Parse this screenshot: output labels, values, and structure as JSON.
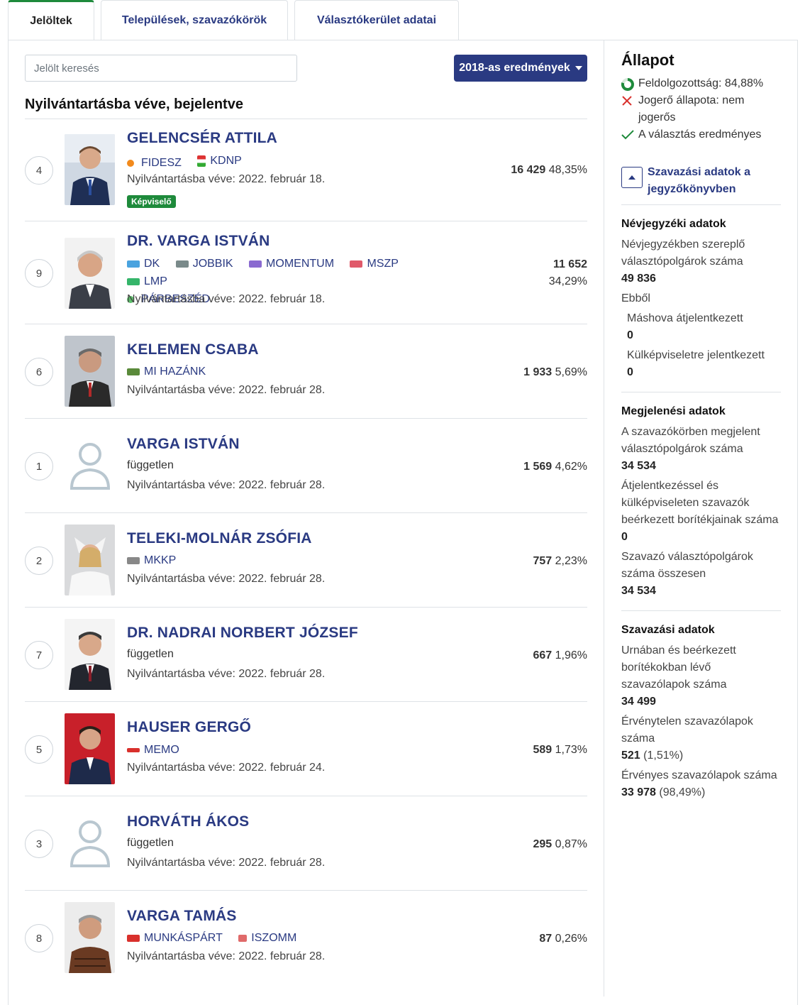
{
  "tabs": [
    {
      "label": "Jelöltek",
      "active": true
    },
    {
      "label": "Települések, szavazókörök",
      "active": false
    },
    {
      "label": "Választókerület adatai",
      "active": false
    }
  ],
  "search": {
    "placeholder": "Jelölt keresés"
  },
  "results_button": {
    "label": "2018-as eredmények"
  },
  "section_title": "Nyilvántartásba véve, bejelentve",
  "candidates": [
    {
      "number": "4",
      "name": "GELENCSÉR ATTILA",
      "parties": [
        "FIDESZ",
        "KDNP"
      ],
      "registered": "Nyilvántartásba véve: 2022. február 18.",
      "badge": "Képviselő",
      "votes": "16 429",
      "percent": "48,35%"
    },
    {
      "number": "9",
      "name": "DR. VARGA ISTVÁN",
      "parties": [
        "DK",
        "JOBBIK",
        "MOMENTUM",
        "MSZP",
        "LMP",
        "PÁRBESZÉD"
      ],
      "registered": "Nyilvántartásba véve: 2022. február 18.",
      "votes": "11 652",
      "percent": "34,29%"
    },
    {
      "number": "6",
      "name": "KELEMEN CSABA",
      "parties": [
        "MI HAZÁNK"
      ],
      "registered": "Nyilvántartásba véve: 2022. február 28.",
      "votes": "1 933",
      "percent": "5,69%"
    },
    {
      "number": "1",
      "name": "VARGA ISTVÁN",
      "independent": "független",
      "registered": "Nyilvántartásba véve: 2022. február 28.",
      "votes": "1 569",
      "percent": "4,62%"
    },
    {
      "number": "2",
      "name": "TELEKI-MOLNÁR ZSÓFIA",
      "parties": [
        "MKKP"
      ],
      "registered": "Nyilvántartásba véve: 2022. február 28.",
      "votes": "757",
      "percent": "2,23%"
    },
    {
      "number": "7",
      "name": "DR. NADRAI NORBERT JÓZSEF",
      "independent": "független",
      "registered": "Nyilvántartásba véve: 2022. február 28.",
      "votes": "667",
      "percent": "1,96%"
    },
    {
      "number": "5",
      "name": "HAUSER GERGŐ",
      "parties": [
        "MEMO"
      ],
      "registered": "Nyilvántartásba véve: 2022. február 24.",
      "votes": "589",
      "percent": "1,73%"
    },
    {
      "number": "3",
      "name": "HORVÁTH ÁKOS",
      "independent": "független",
      "registered": "Nyilvántartásba véve: 2022. február 28.",
      "votes": "295",
      "percent": "0,87%"
    },
    {
      "number": "8",
      "name": "VARGA TAMÁS",
      "parties": [
        "MUNKÁSPÁRT",
        "ISZOMM"
      ],
      "registered": "Nyilvántartásba véve: 2022. február 28.",
      "votes": "87",
      "percent": "0,26%"
    }
  ],
  "sidebar": {
    "title": "Állapot",
    "status": [
      {
        "icon": "progress-icon",
        "text": "Feldolgozottság: 84,88%"
      },
      {
        "icon": "cross-icon",
        "text": "Jogerő állapota: nem jogerős"
      },
      {
        "icon": "check-icon",
        "text": "A választás eredményes"
      }
    ],
    "protocol_button": "Szavazási adatok a jegyzőkönyvben",
    "registry": {
      "heading": "Névjegyzéki adatok",
      "label1": "Névjegyzékben szereplő választópolgárok száma",
      "value1": "49 836",
      "ebbol": "Ebből",
      "label2": "Máshova átjelentkezett",
      "value2": "0",
      "label3": "Külképviseletre jelentkezett",
      "value3": "0"
    },
    "turnout": {
      "heading": "Megjelenési adatok",
      "label1": "A szavazókörben megjelent választópolgárok száma",
      "value1": "34 534",
      "label2": "Átjelentkezéssel és külképviseleten szavazók beérkezett borítékjainak száma",
      "value2": "0",
      "label3": "Szavazó választópolgárok száma összesen",
      "value3": "34 534"
    },
    "voting": {
      "heading": "Szavazási adatok",
      "label1": "Urnában és beérkezett borítékokban lévő szavazólapok száma",
      "value1": "34 499",
      "label2": "Érvénytelen szavazólapok száma",
      "value2": "521",
      "value2_pct": "(1,51%)",
      "label3": "Érvényes szavazólapok száma",
      "value3": "33 978",
      "value3_pct": "(98,49%)"
    }
  },
  "colors": {
    "brand": "#2a3a82",
    "success": "#1e8a3b",
    "danger": "#d9302c"
  }
}
